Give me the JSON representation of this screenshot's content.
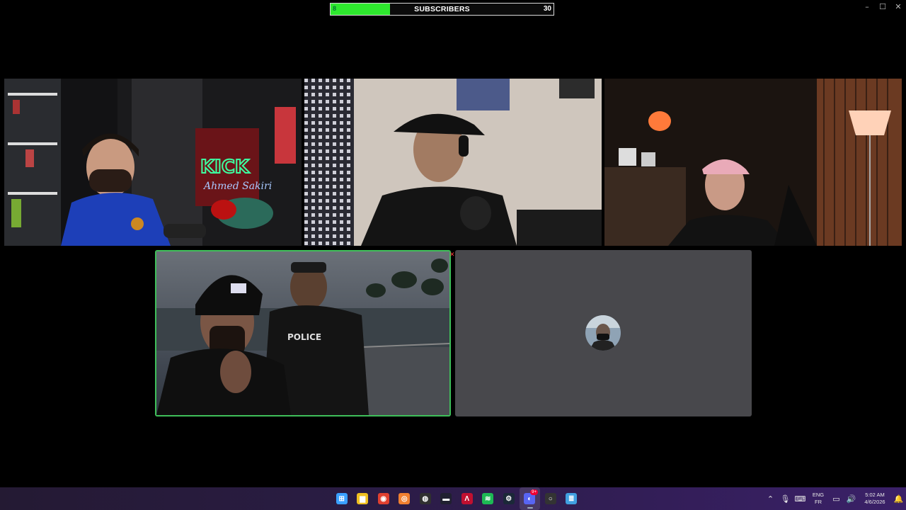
{
  "window": {
    "minimize_icon": "minimize-icon",
    "maximize_icon": "maximize-icon",
    "close_icon": "close-icon"
  },
  "subscriber_goal": {
    "current": "8",
    "label": "SUBSCRIBERS",
    "target": "30",
    "progress_fraction": 0.267,
    "fill_color": "#2ee82e"
  },
  "tiles": {
    "active_speaker_border": "#3fbf5a",
    "idle_tile_color": "#48484c",
    "neon_sign_text": "Ahmed Sakiri"
  },
  "taskbar": {
    "apps": [
      {
        "name": "windows-start",
        "icon": "windows-logo-icon",
        "color": "#3aa0ff"
      },
      {
        "name": "file-explorer",
        "icon": "folder-icon",
        "color": "#f0c020"
      },
      {
        "name": "chrome",
        "icon": "chrome-icon",
        "color": "#e04030"
      },
      {
        "name": "app-orange",
        "icon": "orange-circle-icon",
        "color": "#f08030"
      },
      {
        "name": "obs",
        "icon": "obs-icon",
        "color": "#303030"
      },
      {
        "name": "app-dark",
        "icon": "mask-icon",
        "color": "#202030"
      },
      {
        "name": "app-red",
        "icon": "red-a-icon",
        "color": "#c01030"
      },
      {
        "name": "spotify",
        "icon": "spotify-icon",
        "color": "#1db954"
      },
      {
        "name": "steam",
        "icon": "steam-icon",
        "color": "#1b2838"
      },
      {
        "name": "discord",
        "icon": "discord-icon",
        "color": "#5865f2",
        "badge": "9+",
        "active": true
      },
      {
        "name": "app-circle",
        "icon": "circle-icon",
        "color": "#333"
      },
      {
        "name": "notepad",
        "icon": "notepad-icon",
        "color": "#40a0e0"
      }
    ],
    "tray": {
      "chevron_icon": "chevron-up-icon",
      "mic_icon": "microphone-icon",
      "keyboard_icon": "keyboard-icon",
      "lang_top": "ENG",
      "lang_bottom": "FR",
      "network_icon": "network-icon",
      "volume_icon": "speaker-icon",
      "time": "5:02 AM",
      "date": "4/6/2026",
      "notification_icon": "notification-icon"
    }
  }
}
